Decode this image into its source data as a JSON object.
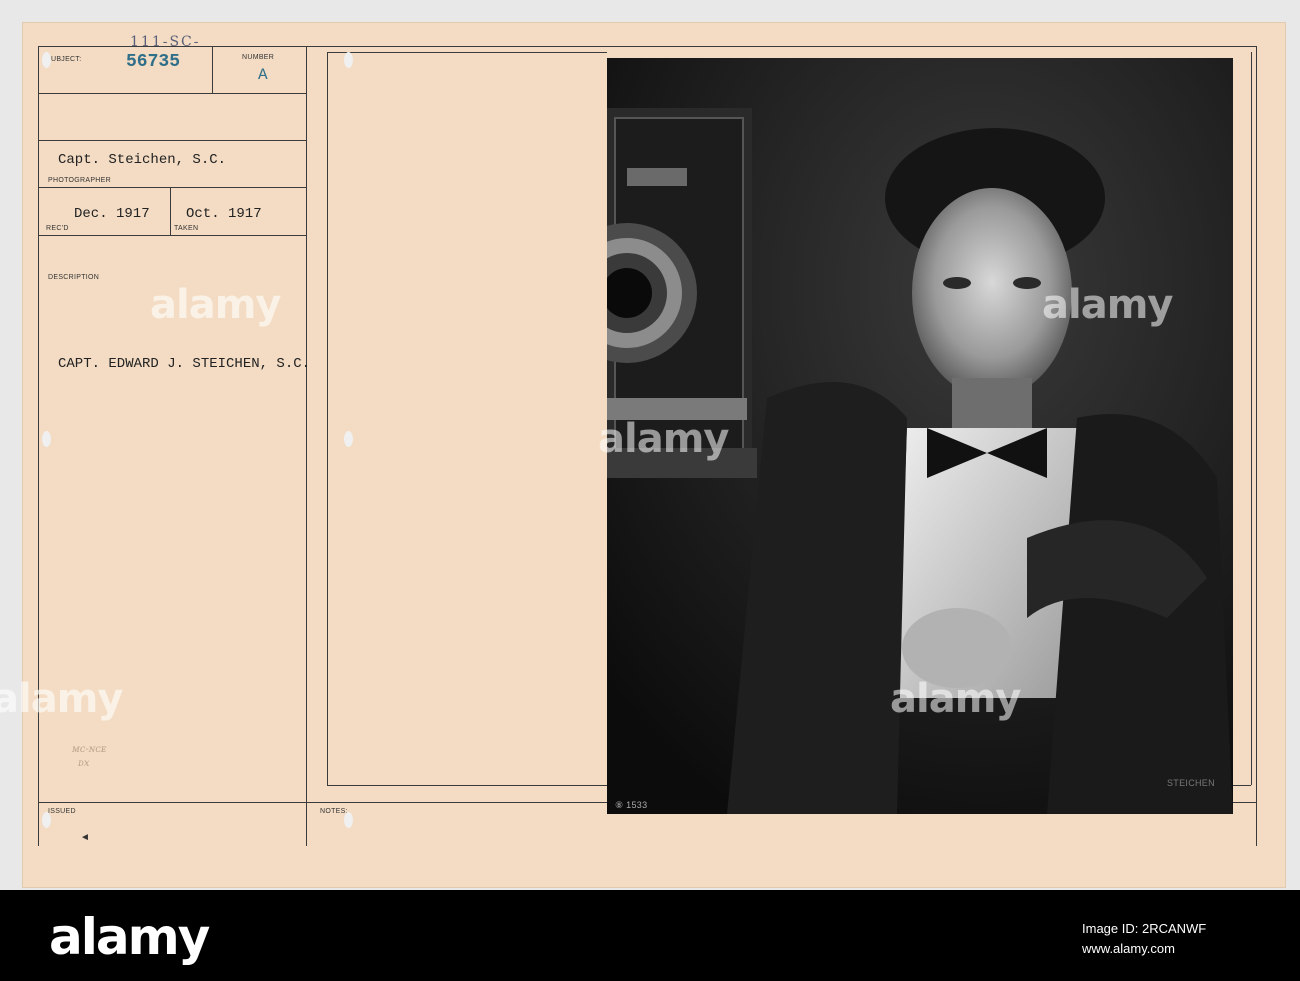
{
  "card": {
    "subject_label": "SUBJECT:",
    "subject_handwritten": "111-SC-",
    "subject_number": "56735",
    "number_label": "NUMBER",
    "number_value": "A",
    "photographer_value": "Capt. Steichen, S.C.",
    "photographer_label": "PHOTOGRAPHER",
    "recd_value": "Dec. 1917",
    "recd_label": "REC'D",
    "taken_value": "Oct. 1917",
    "taken_label": "TAKEN",
    "description_label": "DESCRIPTION",
    "description_value": "CAPT. EDWARD J. STEICHEN, S.C.",
    "pencil_note_1": "ᴍᴄ-ɴᴄᴇ",
    "pencil_note_2": "ᴅx",
    "issued_label": "ISSUED",
    "issued_mark": "◄",
    "notes_label": "NOTES:"
  },
  "photo": {
    "stamp_number": "⑧ 1533",
    "signature": "STEICHEN"
  },
  "watermark": {
    "text": "alamy"
  },
  "footer": {
    "logo": "alamy",
    "image_id_label": "Image ID: 2RCANWF",
    "site": "www.alamy.com"
  },
  "colors": {
    "card": "#f3dcc3",
    "ink_blue": "#2f6f8a",
    "footer": "#000000"
  }
}
